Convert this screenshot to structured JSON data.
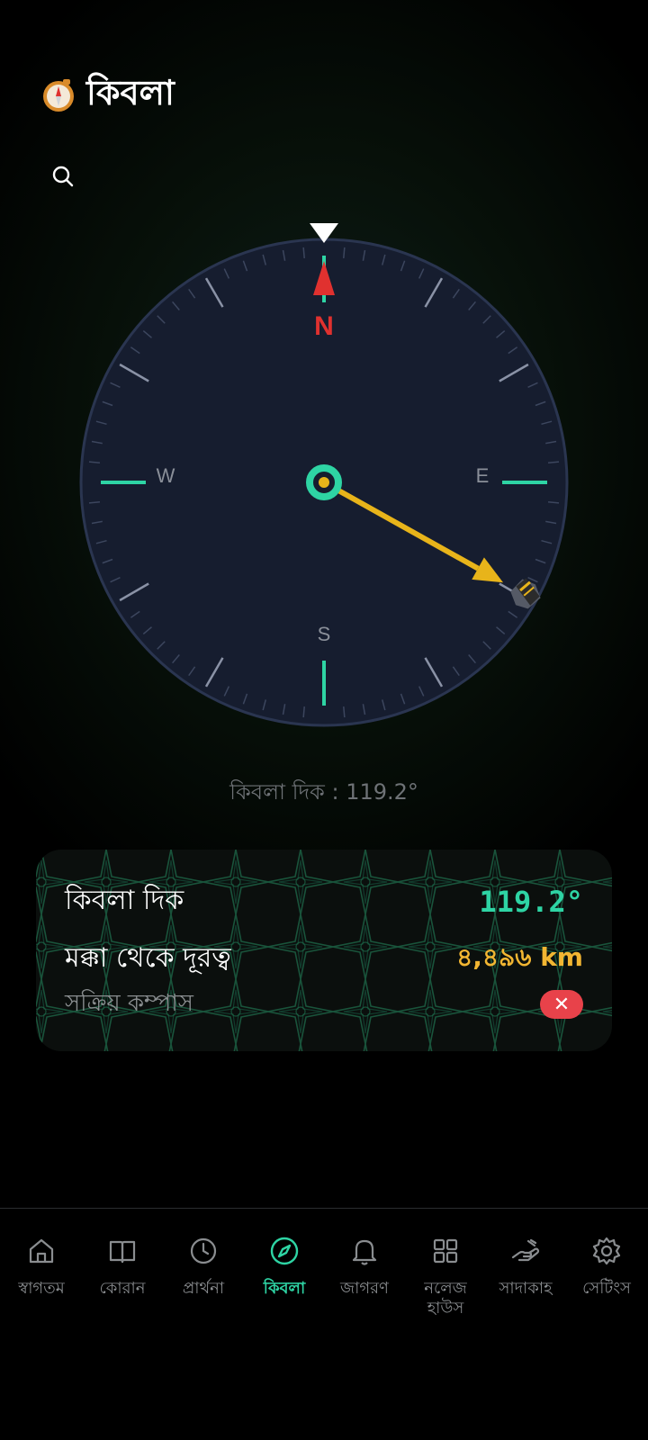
{
  "header": {
    "title": "কিবলা",
    "icon": "compass-emoji-icon"
  },
  "compass": {
    "cardinals": {
      "n": "N",
      "e": "E",
      "s": "S",
      "w": "W"
    },
    "qibla_bearing_deg": 119.2,
    "colors": {
      "accent": "#2ed4a4",
      "arrow": "#e8b41a",
      "north": "#e0312f",
      "dial": "#161d2f"
    }
  },
  "caption": "কিবলা দিক : 119.2°",
  "info": {
    "qibla_label": "কিবলা দিক",
    "qibla_value": "119.2°",
    "distance_label": "মক্কা থেকে দূরত্ব",
    "distance_value": "৪,৪৯৬ km",
    "compass_label": "সক্রিয় কম্পাস",
    "close_symbol": "✕"
  },
  "nav": {
    "items": [
      {
        "label": "স্বাগতম",
        "icon": "home-icon"
      },
      {
        "label": "কোরান",
        "icon": "book-icon"
      },
      {
        "label": "প্রার্থনা",
        "icon": "clock-icon"
      },
      {
        "label": "কিবলা",
        "icon": "compass-icon",
        "active": true
      },
      {
        "label": "জাগরণ",
        "icon": "bell-icon"
      },
      {
        "label": "নলেজ হাউস",
        "icon": "grid-icon"
      },
      {
        "label": "সাদাকাহ",
        "icon": "charity-hand-icon"
      },
      {
        "label": "সেটিংস",
        "icon": "gear-icon"
      }
    ]
  }
}
